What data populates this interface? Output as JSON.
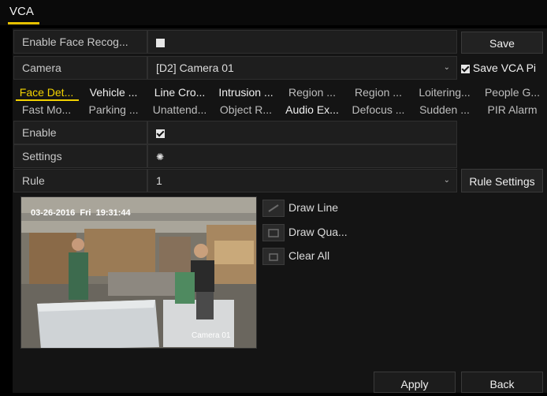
{
  "window": {
    "title": "VCA"
  },
  "top": {
    "enable_label": "Enable Face Recog...",
    "enable_checked": false,
    "save_button": "Save",
    "camera_label": "Camera",
    "camera_value": "[D2] Camera 01",
    "save_vca_label": "Save VCA Pi",
    "save_vca_checked": true
  },
  "tabs_row1": [
    "Face Det...",
    "Vehicle ...",
    "Line Cro...",
    "Intrusion ...",
    "Region ...",
    "Region ...",
    "Loitering...",
    "People G..."
  ],
  "tabs_row2": [
    "Fast Mo...",
    "Parking ...",
    "Unattend...",
    "Object R...",
    "Audio Ex...",
    "Defocus ...",
    "Sudden ...",
    "PIR Alarm"
  ],
  "settings": {
    "enable_label": "Enable",
    "enable_checked": true,
    "settings_label": "Settings",
    "settings_icon": "gear-icon",
    "rule_label": "Rule",
    "rule_value": "1",
    "rule_settings_button": "Rule Settings"
  },
  "video": {
    "timestamp_date": "03-26-2016",
    "timestamp_day": "Fri",
    "timestamp_time": "19:31:44",
    "camera_name": "Camera 01"
  },
  "tools": {
    "draw_line": "Draw Line",
    "draw_quad": "Draw Qua...",
    "clear_all": "Clear All"
  },
  "footer": {
    "apply": "Apply",
    "back": "Back"
  }
}
